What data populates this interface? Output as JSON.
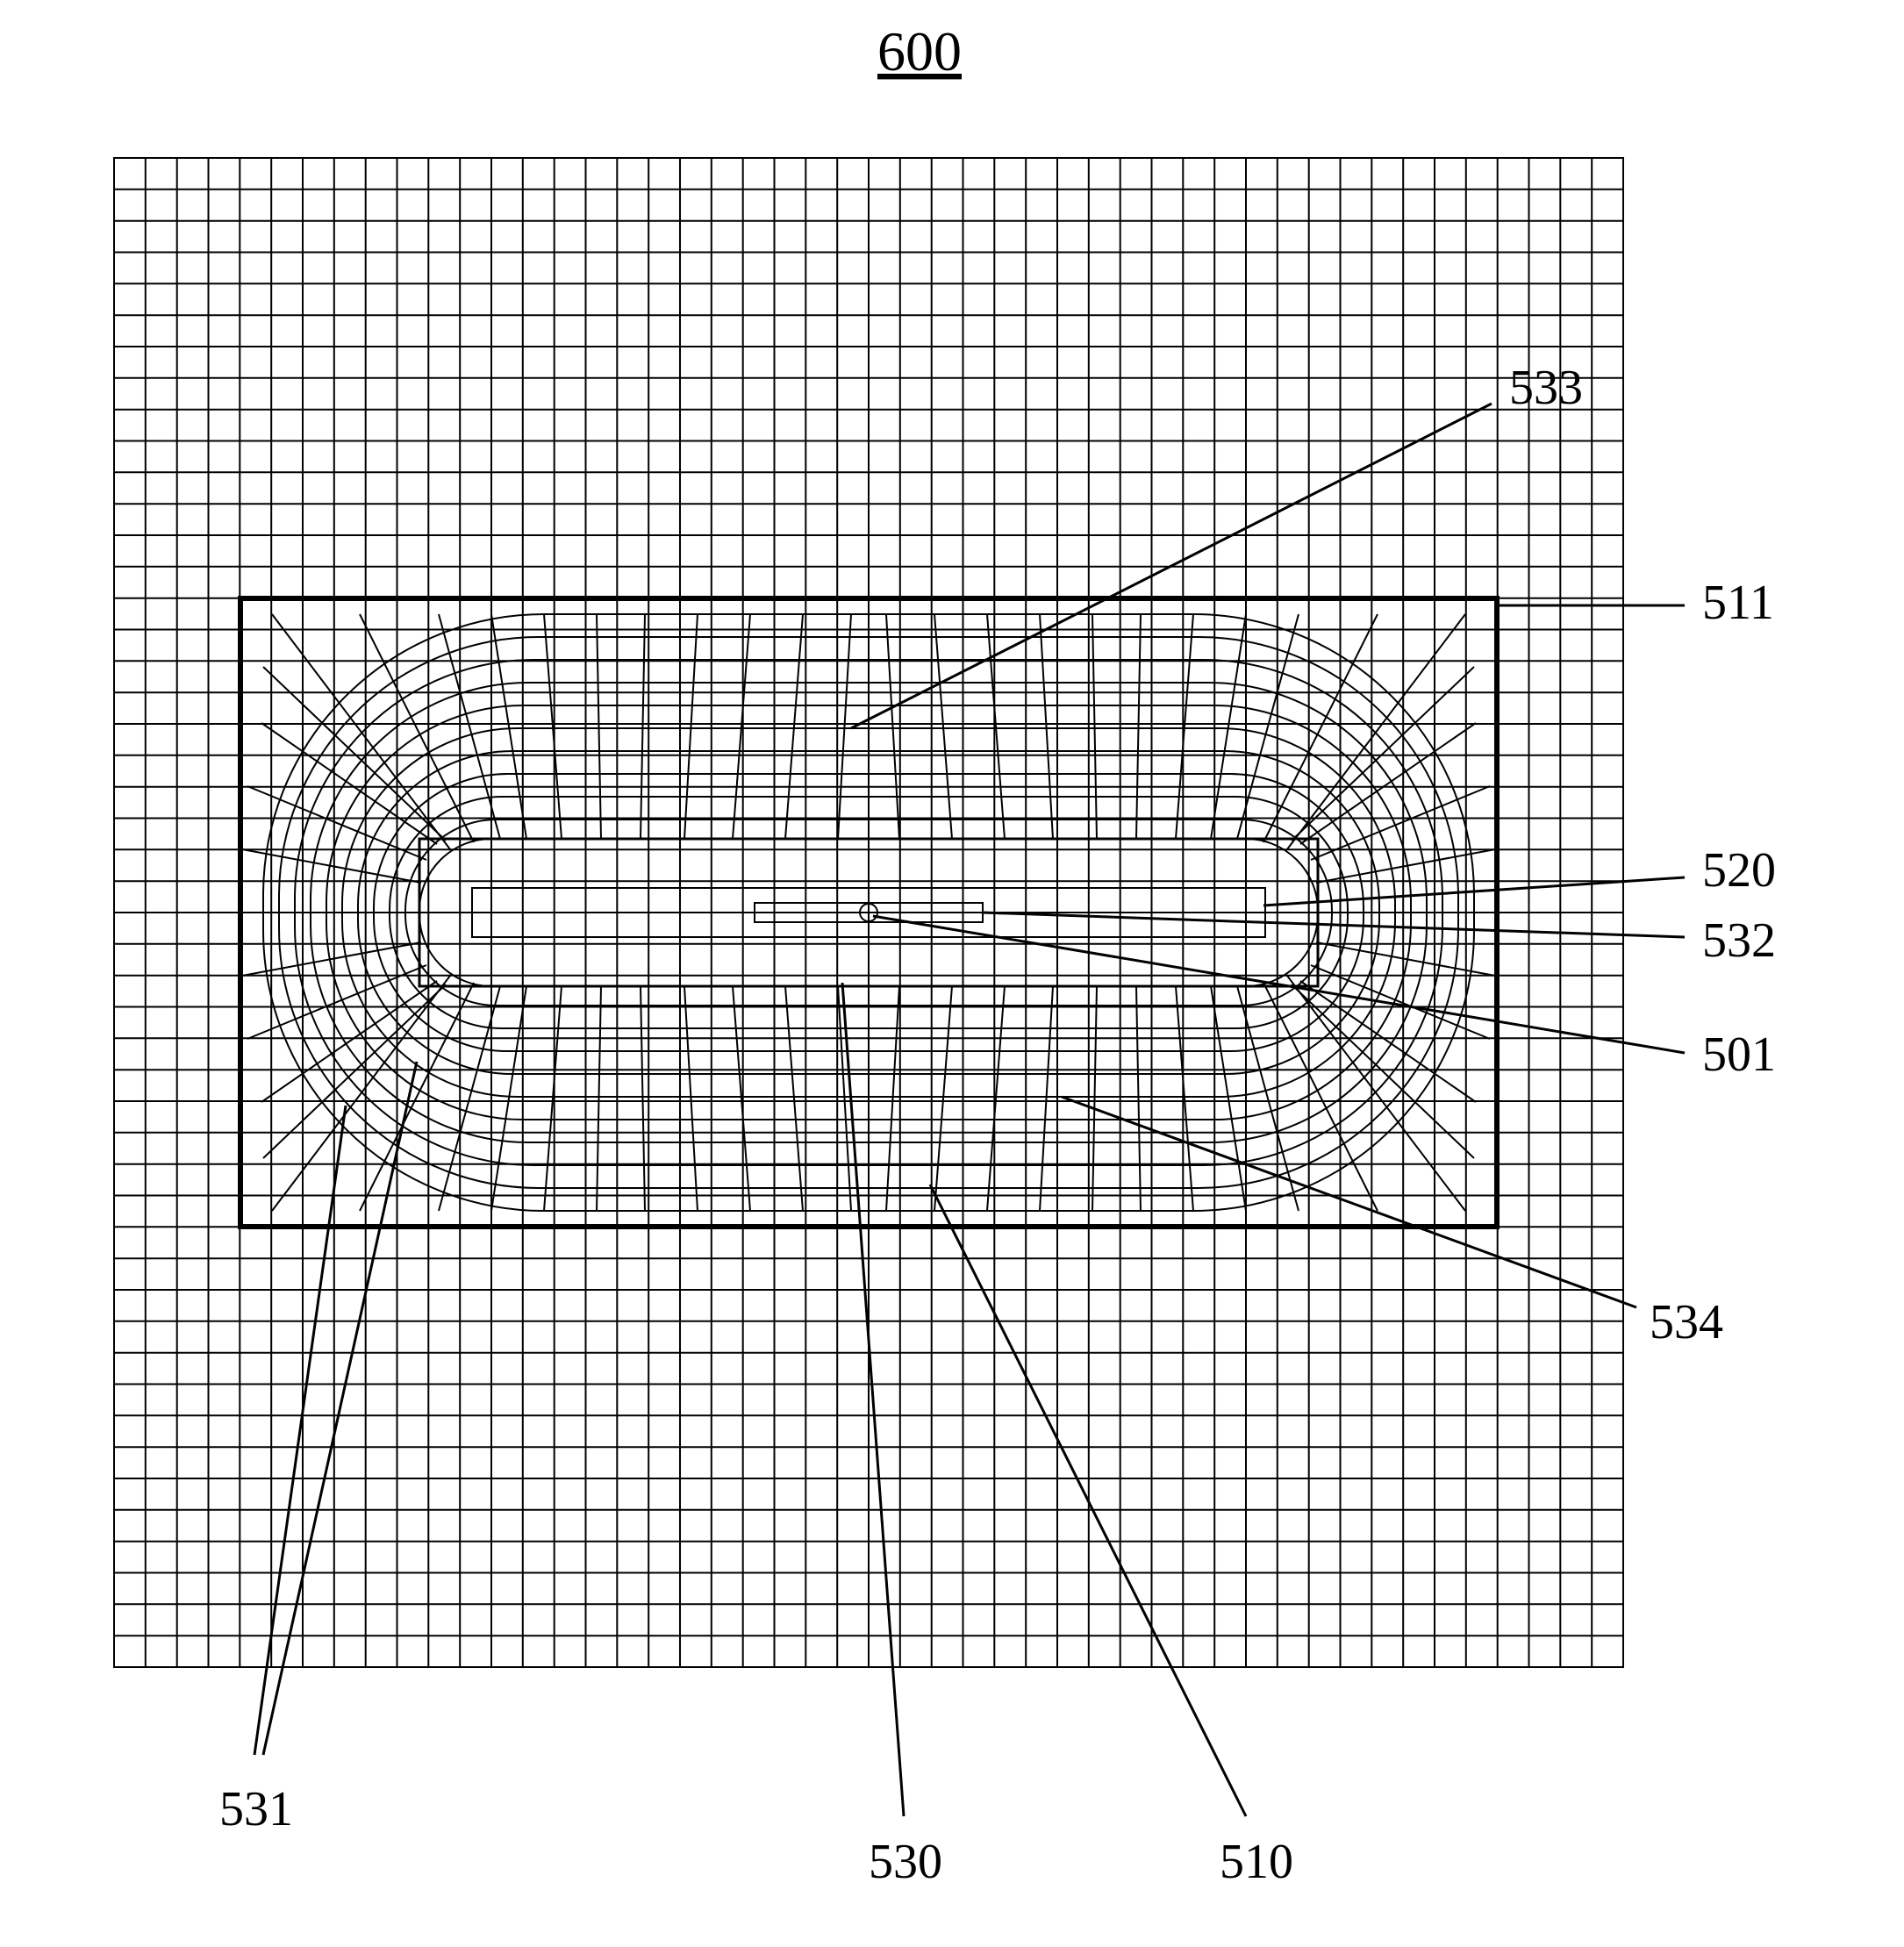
{
  "figure": {
    "title": "600",
    "labels": {
      "l533": "533",
      "l511": "511",
      "l520": "520",
      "l532": "532",
      "l501": "501",
      "l534": "534",
      "l510": "510",
      "l530": "530",
      "l531": "531"
    }
  }
}
